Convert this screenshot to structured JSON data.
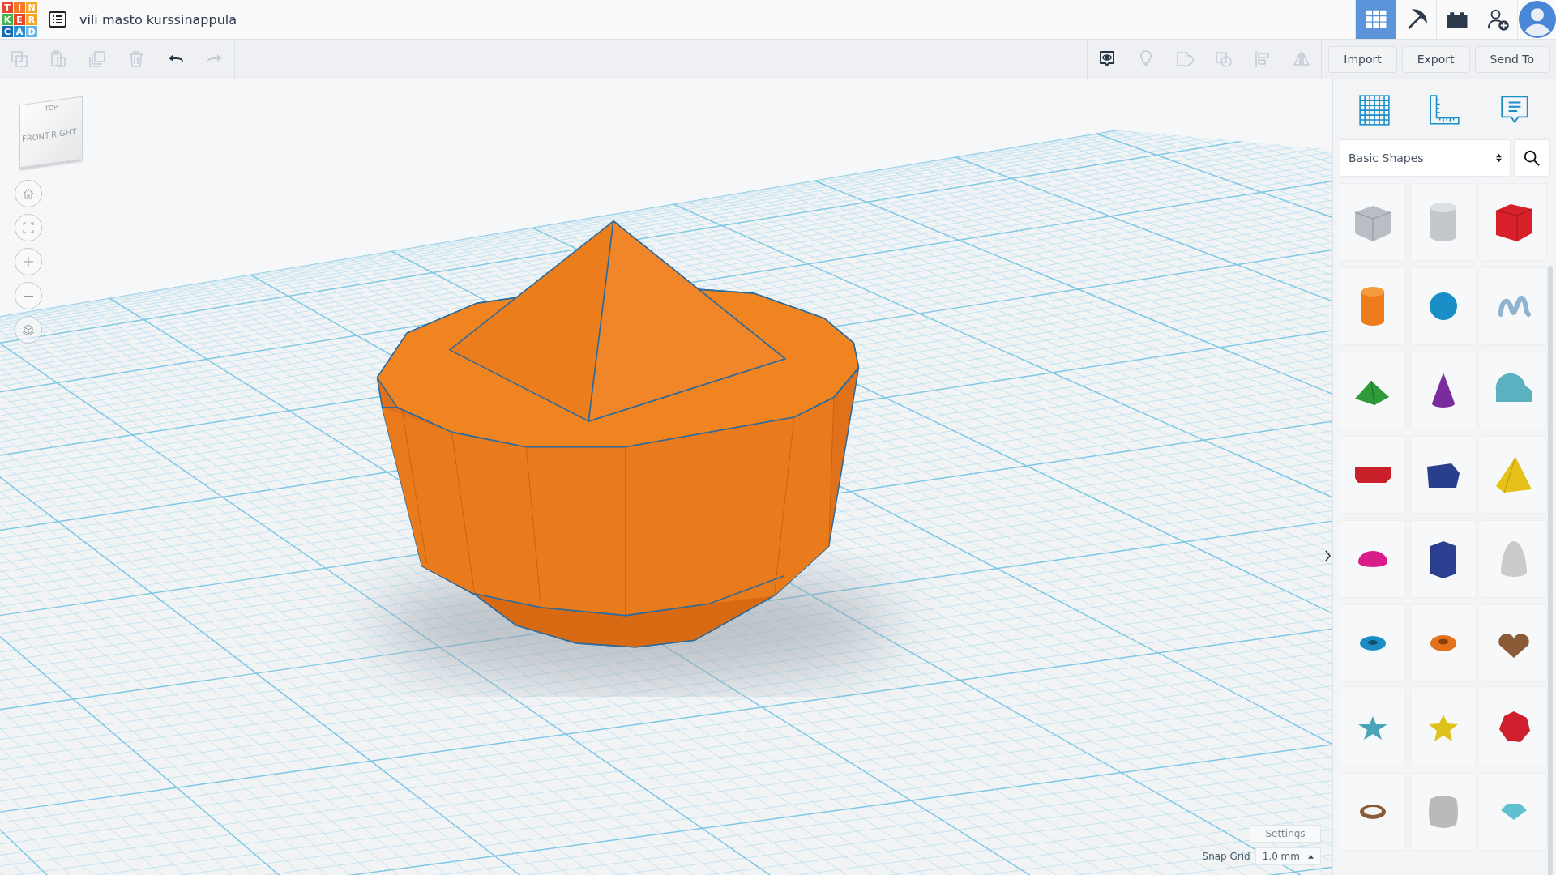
{
  "header": {
    "logo": [
      "T",
      "I",
      "N",
      "K",
      "E",
      "R",
      "C",
      "A",
      "D"
    ],
    "title": "vili masto kurssinappula",
    "modes": [
      {
        "kind": "grid",
        "selected": true
      },
      {
        "kind": "pickaxe",
        "selected": false
      },
      {
        "kind": "bricks",
        "selected": false
      }
    ]
  },
  "toolbar": {
    "edit_tools": [
      {
        "kind": "copy",
        "disabled": true
      },
      {
        "kind": "paste",
        "disabled": true
      },
      {
        "kind": "duplicate",
        "disabled": true
      },
      {
        "kind": "delete",
        "disabled": true
      }
    ],
    "history_tools": [
      {
        "kind": "undo",
        "disabled": false
      },
      {
        "kind": "redo",
        "disabled": true
      }
    ],
    "view_tools": [
      {
        "kind": "note",
        "disabled": false
      },
      {
        "kind": "bulb",
        "disabled": true
      },
      {
        "kind": "group",
        "disabled": true
      },
      {
        "kind": "ungroup",
        "disabled": true
      },
      {
        "kind": "align",
        "disabled": true
      },
      {
        "kind": "mirror",
        "disabled": true
      }
    ],
    "buttons": [
      "Import",
      "Export",
      "Send To"
    ]
  },
  "view_cube": {
    "faces": [
      "TOP",
      "FRONT",
      "RIGHT"
    ]
  },
  "panel": {
    "shape_library": "Basic Shapes"
  },
  "settings": {
    "button": "Settings",
    "snap_grid_label": "Snap Grid",
    "snap_grid_value": "1.0 mm"
  }
}
